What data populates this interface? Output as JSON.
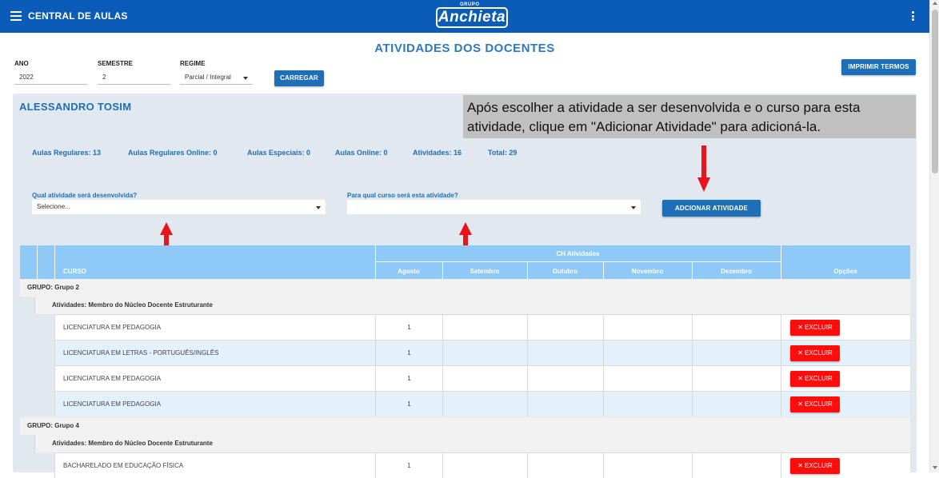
{
  "app": {
    "title": "CENTRAL DE AULAS",
    "logo_small": "GRUPO",
    "logo_main": "Anchieta"
  },
  "page": {
    "title": "ATIVIDADES DOS DOCENTES"
  },
  "filters": {
    "ano_label": "ANO",
    "ano_value": "2022",
    "semestre_label": "SEMESTRE",
    "semestre_value": "2",
    "regime_label": "REGIME",
    "regime_value": "Parcial / Integral",
    "carregar_label": "CARREGAR",
    "imprimir_label": "IMPRIMIR TERMOS"
  },
  "teacher": {
    "name": "ALESSANDRO TOSIM"
  },
  "tooltip": {
    "text": "Após escolher a atividade a ser desenvolvida e o curso para esta atividade, clique em \"Adicionar Atividade\" para adicioná-la."
  },
  "stats": {
    "regulares": "Aulas Regulares: 13",
    "regulares_online": "Aulas Regulares Online: 0",
    "especiais": "Aulas Especiais: 0",
    "online": "Aulas Online: 0",
    "atividades": "Atividades: 16",
    "total": "Total: 29"
  },
  "form": {
    "atividade_label": "Qual atividade será desenvolvida?",
    "atividade_value": "Selecione...",
    "curso_label": "Para qual curso será esta atividade?",
    "curso_value": "",
    "adicionar_label": "ADCIONAR ATIVIDADE"
  },
  "colors": {
    "appbar": "#0b5cb8",
    "accent": "#1e6fb5",
    "table_header": "#8ec9f7",
    "danger": "#ff0d0d",
    "annotation_arrow": "#e8141c"
  },
  "table": {
    "headers": {
      "curso": "CURSO",
      "ch_atividades": "CH Atividades",
      "agosto": "Agosto",
      "setembro": "Setembro",
      "outubro": "Outubro",
      "novembro": "Novembro",
      "dezembro": "Dezembro",
      "opcoes": "Opções"
    },
    "groups": [
      {
        "label": "GRUPO: Grupo 2",
        "activity": "Atividades: Membro do Núcleo Docente Estruturante",
        "rows": [
          {
            "curso": "LICENCIATURA EM PEDAGOGIA",
            "agosto": "1",
            "action": "✕ EXCLUIR"
          },
          {
            "curso": "LICENCIATURA EM LETRAS - PORTUGUÊS/INGLÊS",
            "agosto": "1",
            "action": "✕ EXCLUIR"
          },
          {
            "curso": "LICENCIATURA EM PEDAGOGIA",
            "agosto": "1",
            "action": "✕ EXCLUIR"
          },
          {
            "curso": "LICENCIATURA EM PEDAGOGIA",
            "agosto": "1",
            "action": "✕ EXCLUIR"
          }
        ]
      },
      {
        "label": "GRUPO: Grupo 4",
        "activity": "Atividades: Membro do Núcleo Docente Estruturante",
        "rows": [
          {
            "curso": "BACHARELADO EM EDUCAÇÃO FÍSICA",
            "agosto": "1",
            "action": "✕ EXCLUIR"
          }
        ]
      }
    ]
  }
}
